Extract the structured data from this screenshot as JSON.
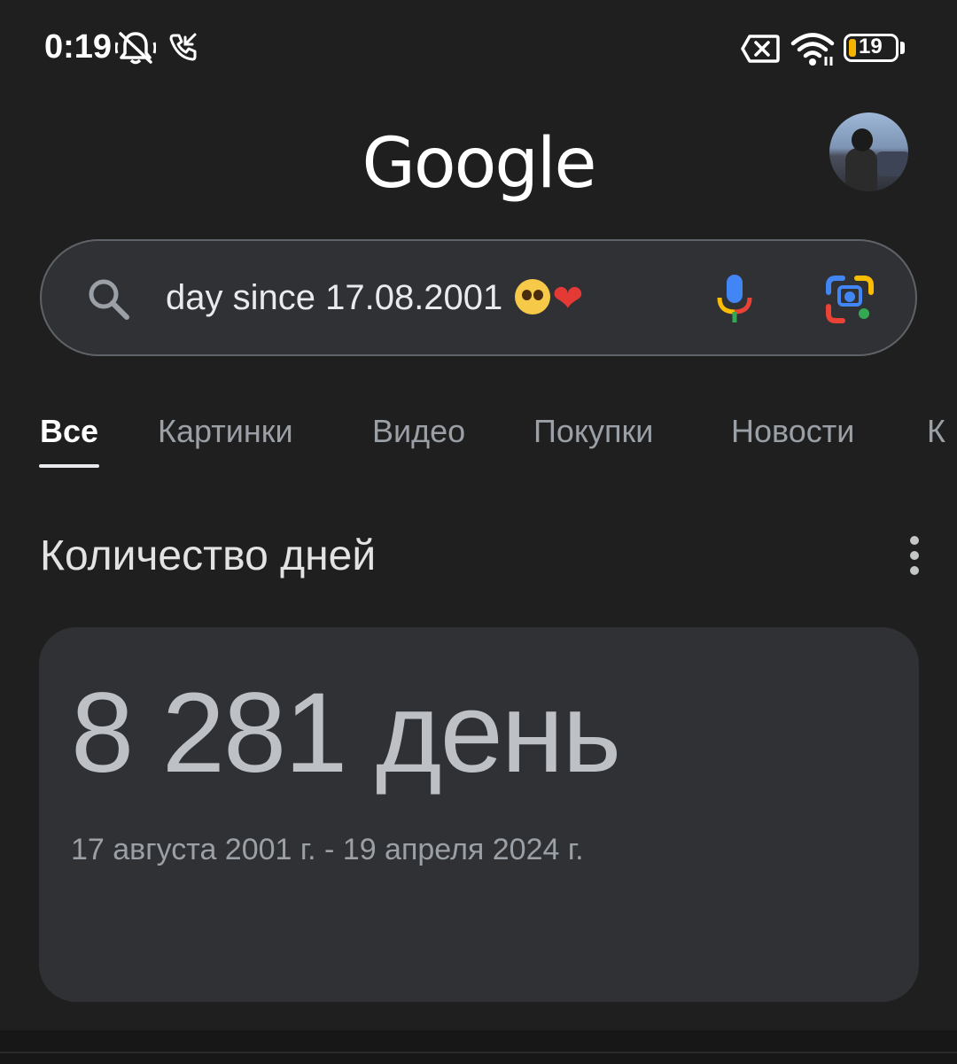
{
  "status_bar": {
    "time": "0:19",
    "battery_level": "19",
    "icons": [
      "mute-icon",
      "missed-call-icon",
      "no-sim-icon",
      "wifi-icon",
      "battery-icon"
    ]
  },
  "header": {
    "logo": "Google",
    "avatar": "user-avatar"
  },
  "search": {
    "query": "day since 17.08.2001",
    "emoji": [
      "pleading-face",
      "broken-heart"
    ],
    "icons": [
      "search-icon",
      "mic-icon",
      "google-lens-icon"
    ]
  },
  "tabs": [
    {
      "label": "Все",
      "active": true
    },
    {
      "label": "Картинки",
      "active": false
    },
    {
      "label": "Видео",
      "active": false
    },
    {
      "label": "Покупки",
      "active": false
    },
    {
      "label": "Новости",
      "active": false
    },
    {
      "label": "К",
      "active": false
    }
  ],
  "result": {
    "title": "Количество дней",
    "value": "8 281 день",
    "date_range": "17 августа 2001 г. - 19 апреля 2024 г."
  },
  "colors": {
    "background": "#1f1f1f",
    "card": "#303134",
    "accent_blue": "#4285f4",
    "accent_red": "#ea4335",
    "accent_yellow": "#fbbc04",
    "accent_green": "#34a853"
  }
}
